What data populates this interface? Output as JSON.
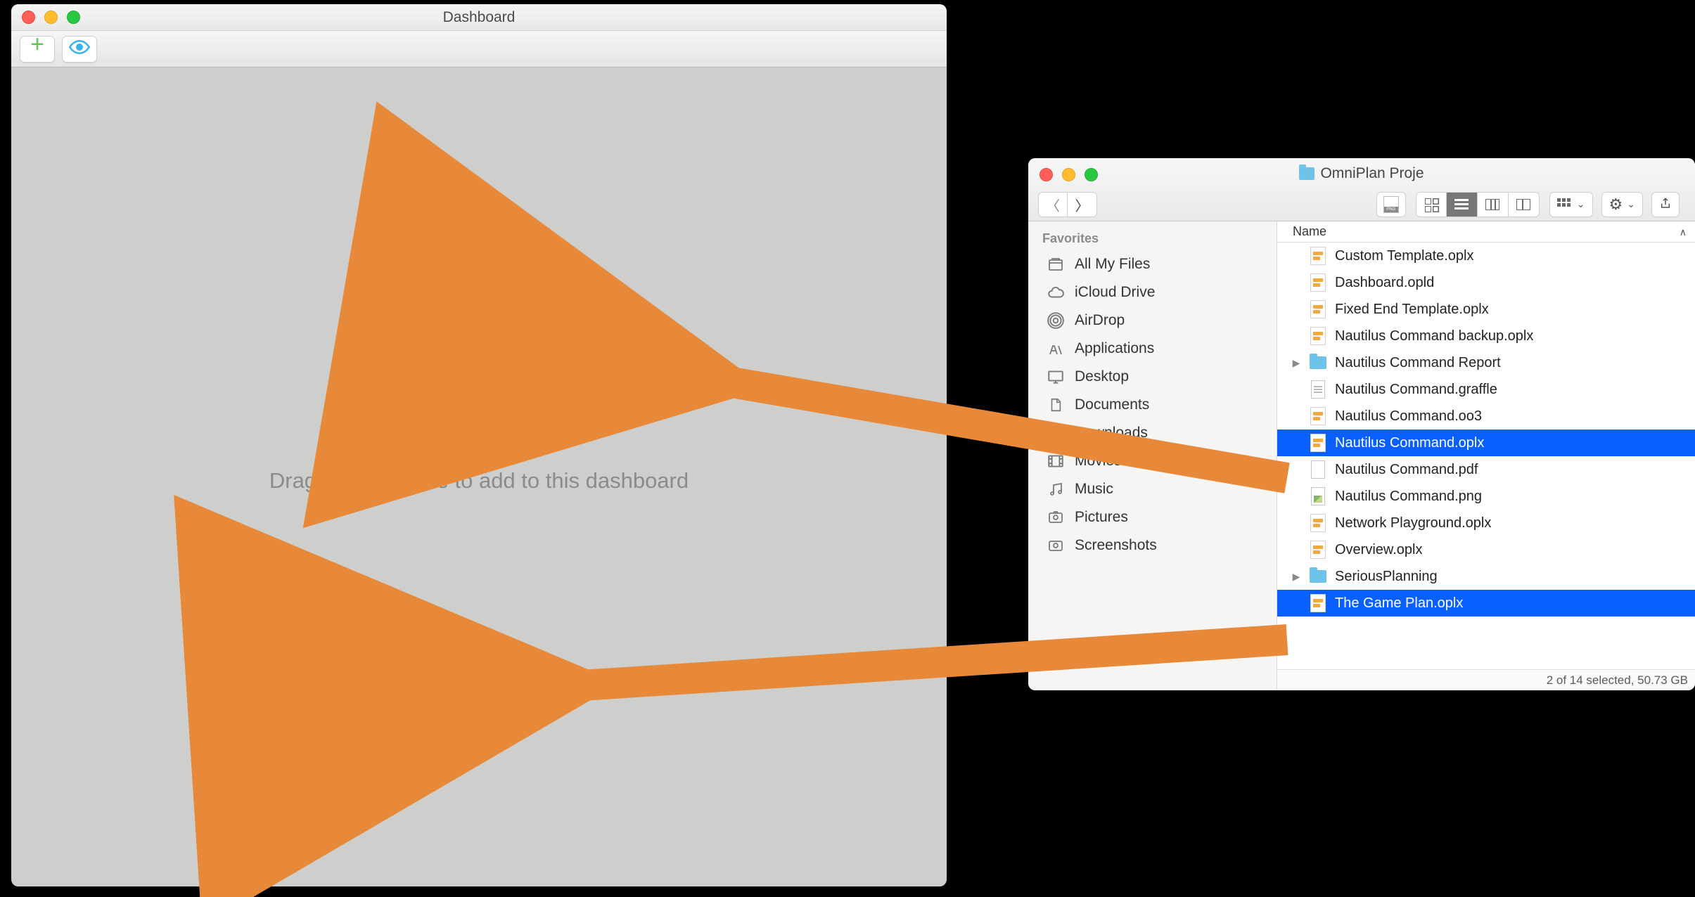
{
  "dashboard": {
    "title": "Dashboard",
    "hint": "Drag projects here to add to this dashboard"
  },
  "finder": {
    "title": "OmniPlan Proje",
    "column_header": "Name",
    "status": "2 of 14 selected, 50.73 GB",
    "sidebar": {
      "header": "Favorites",
      "items": [
        {
          "icon": "all-my-files",
          "label": "All My Files"
        },
        {
          "icon": "icloud",
          "label": "iCloud Drive"
        },
        {
          "icon": "airdrop",
          "label": "AirDrop"
        },
        {
          "icon": "applications",
          "label": "Applications"
        },
        {
          "icon": "desktop",
          "label": "Desktop"
        },
        {
          "icon": "documents",
          "label": "Documents"
        },
        {
          "icon": "downloads",
          "label": "Downloads"
        },
        {
          "icon": "movies",
          "label": "Movies"
        },
        {
          "icon": "music",
          "label": "Music"
        },
        {
          "icon": "pictures",
          "label": "Pictures"
        },
        {
          "icon": "screenshots",
          "label": "Screenshots"
        }
      ]
    },
    "files": [
      {
        "type": "oplx",
        "name": "Custom Template.oplx",
        "selected": false,
        "folder": false
      },
      {
        "type": "oplx",
        "name": "Dashboard.opld",
        "selected": false,
        "folder": false
      },
      {
        "type": "oplx",
        "name": "Fixed End Template.oplx",
        "selected": false,
        "folder": false
      },
      {
        "type": "oplx",
        "name": "Nautilus Command backup.oplx",
        "selected": false,
        "folder": false
      },
      {
        "type": "folder",
        "name": "Nautilus Command Report",
        "selected": false,
        "folder": true
      },
      {
        "type": "doc",
        "name": "Nautilus Command.graffle",
        "selected": false,
        "folder": false
      },
      {
        "type": "oplx",
        "name": "Nautilus Command.oo3",
        "selected": false,
        "folder": false
      },
      {
        "type": "oplx",
        "name": "Nautilus Command.oplx",
        "selected": true,
        "folder": false
      },
      {
        "type": "pdf",
        "name": "Nautilus Command.pdf",
        "selected": false,
        "folder": false
      },
      {
        "type": "png",
        "name": "Nautilus Command.png",
        "selected": false,
        "folder": false
      },
      {
        "type": "oplx",
        "name": "Network Playground.oplx",
        "selected": false,
        "folder": false
      },
      {
        "type": "oplx",
        "name": "Overview.oplx",
        "selected": false,
        "folder": false
      },
      {
        "type": "folder",
        "name": "SeriousPlanning",
        "selected": false,
        "folder": true
      },
      {
        "type": "oplx",
        "name": "The Game Plan.oplx",
        "selected": true,
        "folder": false
      }
    ]
  }
}
